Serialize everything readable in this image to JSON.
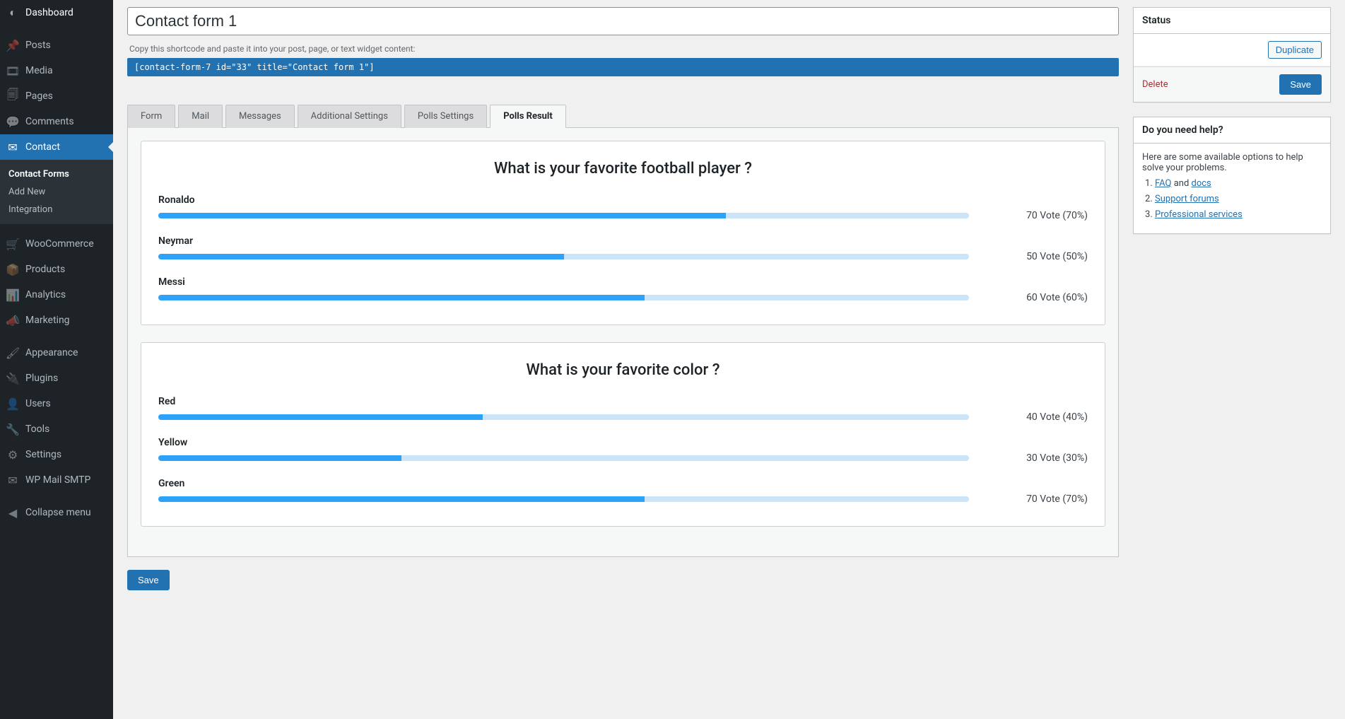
{
  "sidebar": {
    "items": [
      {
        "label": "Dashboard",
        "icon": "◐"
      },
      {
        "label": "Posts",
        "icon": "📌"
      },
      {
        "label": "Media",
        "icon": "🎞"
      },
      {
        "label": "Pages",
        "icon": "🗐"
      },
      {
        "label": "Comments",
        "icon": "💬"
      },
      {
        "label": "Contact",
        "icon": "✉"
      },
      {
        "label": "WooCommerce",
        "icon": "🛒"
      },
      {
        "label": "Products",
        "icon": "📦"
      },
      {
        "label": "Analytics",
        "icon": "📊"
      },
      {
        "label": "Marketing",
        "icon": "📣"
      },
      {
        "label": "Appearance",
        "icon": "🖌"
      },
      {
        "label": "Plugins",
        "icon": "🔌"
      },
      {
        "label": "Users",
        "icon": "👤"
      },
      {
        "label": "Tools",
        "icon": "🔧"
      },
      {
        "label": "Settings",
        "icon": "⚙"
      },
      {
        "label": "WP Mail SMTP",
        "icon": "✉"
      },
      {
        "label": "Collapse menu",
        "icon": "◀"
      }
    ],
    "contact_sub": [
      {
        "label": "Contact Forms",
        "current": true
      },
      {
        "label": "Add New",
        "current": false
      },
      {
        "label": "Integration",
        "current": false
      }
    ]
  },
  "title": "Contact form 1",
  "shortcode_hint": "Copy this shortcode and paste it into your post, page, or text widget content:",
  "shortcode": "[contact-form-7 id=\"33\" title=\"Contact form 1\"]",
  "tabs": [
    "Form",
    "Mail",
    "Messages",
    "Additional Settings",
    "Polls Settings",
    "Polls Result"
  ],
  "active_tab": "Polls Result",
  "chart_data": [
    {
      "type": "bar",
      "title": "What is your favorite football player ?",
      "categories": [
        "Ronaldo",
        "Neymar",
        "Messi"
      ],
      "votes": [
        70,
        50,
        60
      ],
      "percents": [
        70,
        50,
        60
      ],
      "vote_texts": [
        "70 Vote (70%)",
        "50 Vote (50%)",
        "60 Vote (60%)"
      ]
    },
    {
      "type": "bar",
      "title": "What is your favorite color ?",
      "categories": [
        "Red",
        "Yellow",
        "Green"
      ],
      "votes": [
        40,
        30,
        70
      ],
      "percents": [
        40,
        30,
        60
      ],
      "vote_texts": [
        "40 Vote (40%)",
        "30 Vote (30%)",
        "70 Vote (70%)"
      ]
    }
  ],
  "save_label": "Save",
  "status_box": {
    "heading": "Status",
    "duplicate_label": "Duplicate",
    "delete_label": "Delete",
    "save_label": "Save"
  },
  "help_box": {
    "heading": "Do you need help?",
    "intro": "Here are some available options to help solve your problems.",
    "items": [
      {
        "prefix": "",
        "link": "FAQ",
        "mid": " and ",
        "link2": "docs"
      },
      {
        "link": "Support forums"
      },
      {
        "link": "Professional services"
      }
    ]
  }
}
